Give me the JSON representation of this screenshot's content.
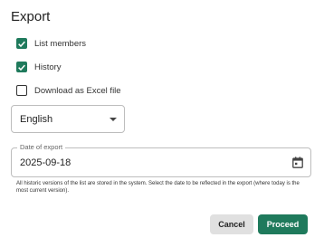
{
  "dialog": {
    "title": "Export",
    "options": [
      {
        "label": "List members",
        "checked": true
      },
      {
        "label": "History",
        "checked": true
      },
      {
        "label": "Download as Excel file",
        "checked": false
      }
    ],
    "language": {
      "selected": "English"
    },
    "date": {
      "label": "Date of export",
      "value": "2025-09-18",
      "icon": "calendar-icon"
    },
    "help_text": "All historic versions of the list are stored in the system. Select the date to be reflected in the export (where today is the most current version).",
    "buttons": {
      "cancel": "Cancel",
      "proceed": "Proceed"
    }
  },
  "colors": {
    "accent": "#1f7a5c",
    "cancel_bg": "#e0e0e0"
  }
}
